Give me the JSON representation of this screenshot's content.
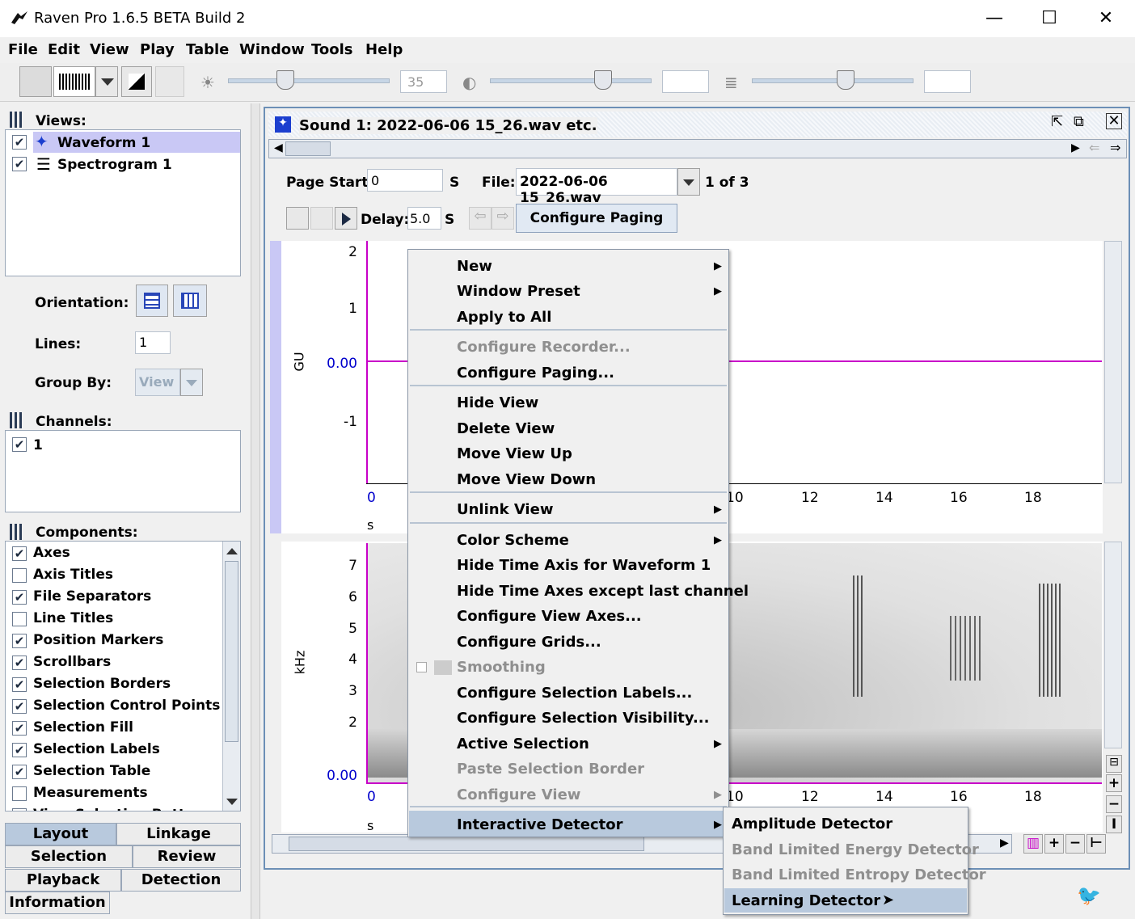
{
  "window": {
    "title": "Raven Pro 1.6.5 BETA Build 2",
    "minimize": "—",
    "maximize": "☐",
    "close": "✕"
  },
  "menubar": [
    "File",
    "Edit",
    "View",
    "Play",
    "Table",
    "Window",
    "Tools",
    "Help"
  ],
  "toolbar": {
    "brightness_value": "35",
    "contrast_value": "",
    "resolution_value": ""
  },
  "left": {
    "views_header": "Views:",
    "views": [
      {
        "label": "Waveform 1",
        "icon": "waveform-icon"
      },
      {
        "label": "Spectrogram 1",
        "icon": "spectrogram-icon"
      }
    ],
    "orientation_label": "Orientation:",
    "lines_label": "Lines:",
    "lines_value": "1",
    "groupby_label": "Group By:",
    "groupby_value": "View",
    "channels_header": "Channels:",
    "channels": [
      "1"
    ],
    "components_header": "Components:",
    "components": [
      {
        "label": "Axes",
        "checked": true
      },
      {
        "label": "Axis Titles",
        "checked": false
      },
      {
        "label": "File Separators",
        "checked": true
      },
      {
        "label": "Line Titles",
        "checked": false
      },
      {
        "label": "Position Markers",
        "checked": true
      },
      {
        "label": "Scrollbars",
        "checked": true
      },
      {
        "label": "Selection Borders",
        "checked": true
      },
      {
        "label": "Selection Control Points",
        "checked": true
      },
      {
        "label": "Selection Fill",
        "checked": true
      },
      {
        "label": "Selection Labels",
        "checked": true
      },
      {
        "label": "Selection Table",
        "checked": true
      },
      {
        "label": "Measurements",
        "checked": false
      },
      {
        "label": "View Selection Butto",
        "checked": true
      }
    ],
    "tabs": [
      "Layout",
      "Linkage",
      "Selection",
      "Review",
      "Playback",
      "Detection",
      "Information"
    ]
  },
  "doc": {
    "title": "Sound 1: 2022-06-06 15_26.wav etc.",
    "page_start_label": "Page Start:",
    "page_start_value": "0",
    "s": "S",
    "file_label": "File:",
    "file_value": "2022-06-06 15_26.wav",
    "file_count": "1 of 3",
    "delay_label": "Delay:",
    "delay_value": "5.0",
    "configure_paging": "Configure Paging",
    "wave": {
      "ylabel": "GU",
      "yticks": [
        "2",
        "1",
        "0.00",
        "-1"
      ],
      "xticks": [
        "0",
        "10",
        "12",
        "14",
        "16",
        "18"
      ],
      "xunit": "s"
    },
    "spec": {
      "ylabel": "kHz",
      "yticks": [
        "7",
        "6",
        "5",
        "4",
        "3",
        "2",
        "0.00"
      ],
      "xticks": [
        "0",
        "10",
        "12",
        "14",
        "16",
        "18"
      ],
      "xunit": "s"
    }
  },
  "context_menu": {
    "items": [
      "New",
      "Window Preset",
      "Apply to All",
      "Configure Recorder...",
      "Configure Paging...",
      "Hide View",
      "Delete View",
      "Move View Up",
      "Move View Down",
      "Unlink View",
      "Color Scheme",
      "Hide Time Axis for Waveform 1",
      "Hide Time Axes except last channel",
      "Configure View Axes...",
      "Configure Grids...",
      "Smoothing",
      "Configure Selection Labels...",
      "Configure Selection Visibility...",
      "Active Selection",
      "Paste Selection Border",
      "Configure View",
      "Interactive Detector"
    ]
  },
  "submenu": {
    "items": [
      "Amplitude Detector",
      "Band Limited Energy Detector",
      "Band Limited Entropy Detector",
      "Learning Detector"
    ]
  },
  "colors": {
    "highlight": "#b8c9dd",
    "waveform": "#c800c8",
    "axis_blue": "#0000cc"
  }
}
